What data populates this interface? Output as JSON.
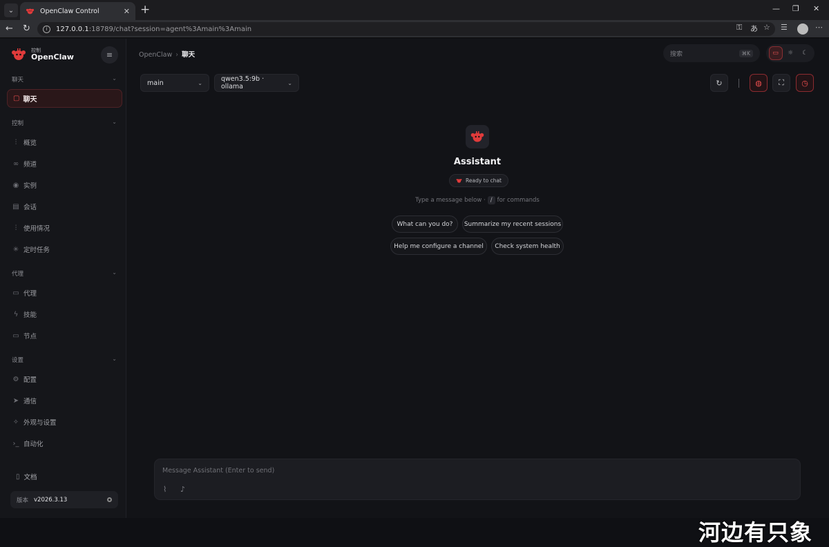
{
  "browser": {
    "tab_title": "OpenClaw Control",
    "url_host": "127.0.0.1",
    "url_path": ":18789/chat?session=agent%3Amain%3Amain"
  },
  "sidebar": {
    "brand_small": "控制",
    "brand_name": "OpenClaw",
    "sections": [
      {
        "title": "聊天",
        "items": [
          {
            "label": "聊天",
            "icon": "chat-bubble-icon",
            "active": true
          }
        ]
      },
      {
        "title": "控制",
        "items": [
          {
            "label": "概览",
            "icon": "bar-chart-icon"
          },
          {
            "label": "频道",
            "icon": "link-icon"
          },
          {
            "label": "实例",
            "icon": "broadcast-icon"
          },
          {
            "label": "会话",
            "icon": "document-icon"
          },
          {
            "label": "使用情况",
            "icon": "bar-chart-icon"
          },
          {
            "label": "定时任务",
            "icon": "loader-icon"
          }
        ]
      },
      {
        "title": "代理",
        "items": [
          {
            "label": "代理",
            "icon": "folder-icon"
          },
          {
            "label": "技能",
            "icon": "lightning-icon"
          },
          {
            "label": "节点",
            "icon": "monitor-icon"
          }
        ]
      },
      {
        "title": "设置",
        "items": [
          {
            "label": "配置",
            "icon": "gear-icon"
          },
          {
            "label": "通信",
            "icon": "send-icon"
          },
          {
            "label": "外观与设置",
            "icon": "sparkle-icon"
          },
          {
            "label": "自动化",
            "icon": "terminal-icon"
          }
        ]
      }
    ],
    "docs_label": "文档",
    "version_key": "版本",
    "version_value": "v2026.3.13"
  },
  "header": {
    "breadcrumb_root": "OpenClaw",
    "breadcrumb_current": "聊天",
    "search_placeholder": "搜索",
    "search_shortcut": "⌘K"
  },
  "toolbar": {
    "agent_select": "main",
    "model_select": "qwen3.5:9b · ollama"
  },
  "welcome": {
    "name": "Assistant",
    "status": "Ready to chat",
    "hint_before": "Type a message below ·",
    "hint_key": "/",
    "hint_after": "for commands",
    "suggestions": [
      "What can you do?",
      "Summarize my recent sessions",
      "Help me configure a channel",
      "Check system health"
    ]
  },
  "composer": {
    "placeholder": "Message Assistant (Enter to send)"
  },
  "watermark": "河边有只象",
  "colors": {
    "accent": "#e34b4b",
    "background": "#121317",
    "sidebar": "#15161a"
  }
}
